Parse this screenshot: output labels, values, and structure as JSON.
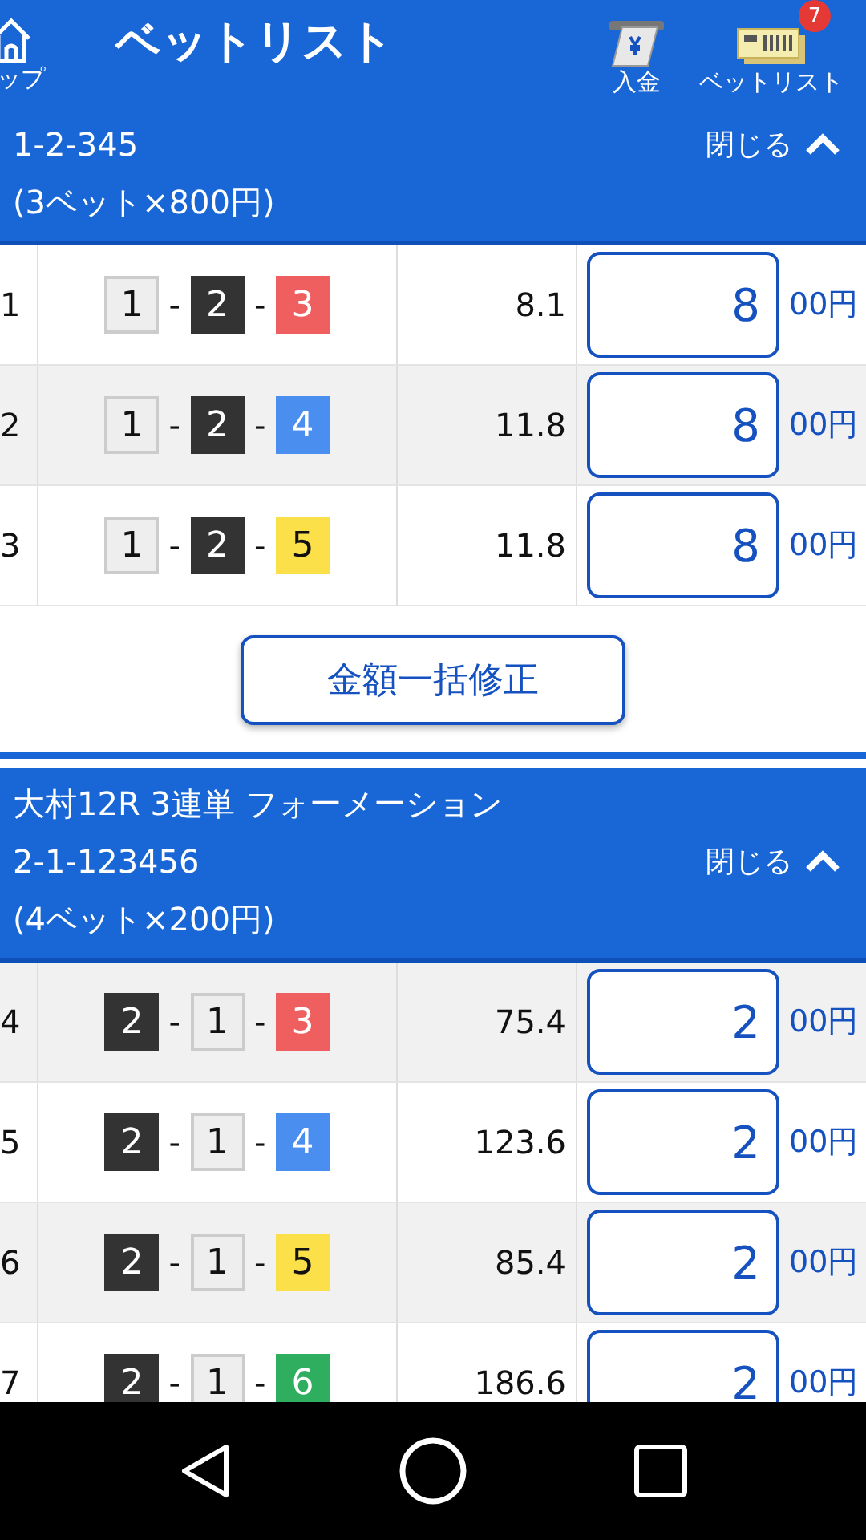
{
  "header": {
    "home_label": "ップ",
    "title": "ベットリスト",
    "actions": [
      {
        "kind": "deposit",
        "label": "入金"
      },
      {
        "kind": "betlist",
        "label": "ベットリスト",
        "badge": "7"
      }
    ]
  },
  "sections": [
    {
      "title_lines": [
        "1-2-345",
        "(3ベット×800円)"
      ],
      "toggle": "閉じる",
      "rows": [
        {
          "no": "1",
          "boats": [
            {
              "n": "1",
              "color": "#eeeeee"
            },
            {
              "n": "2",
              "color": "#333333"
            },
            {
              "n": "3",
              "color": "#ef5f5f"
            }
          ],
          "sep": "-",
          "odds": "8.1",
          "amount": "8",
          "unit": "00円"
        },
        {
          "no": "2",
          "boats": [
            {
              "n": "1",
              "color": "#eeeeee"
            },
            {
              "n": "2",
              "color": "#333333"
            },
            {
              "n": "4",
              "color": "#4a8ef0"
            }
          ],
          "sep": "-",
          "odds": "11.8",
          "amount": "8",
          "unit": "00円"
        },
        {
          "no": "3",
          "boats": [
            {
              "n": "1",
              "color": "#eeeeee"
            },
            {
              "n": "2",
              "color": "#333333"
            },
            {
              "n": "5",
              "color": "#fbe04a"
            }
          ],
          "sep": "-",
          "odds": "11.8",
          "amount": "8",
          "unit": "00円"
        }
      ],
      "button": "金額一括修正"
    },
    {
      "title_lines": [
        "大村12R 3連単 フォーメーション",
        "2-1-123456",
        "(4ベット×200円)"
      ],
      "toggle": "閉じる",
      "rows": [
        {
          "no": "4",
          "boats": [
            {
              "n": "2",
              "color": "#333333"
            },
            {
              "n": "1",
              "color": "#eeeeee"
            },
            {
              "n": "3",
              "color": "#ef5f5f"
            }
          ],
          "sep": "-",
          "odds": "75.4",
          "amount": "2",
          "unit": "00円"
        },
        {
          "no": "5",
          "boats": [
            {
              "n": "2",
              "color": "#333333"
            },
            {
              "n": "1",
              "color": "#eeeeee"
            },
            {
              "n": "4",
              "color": "#4a8ef0"
            }
          ],
          "sep": "-",
          "odds": "123.6",
          "amount": "2",
          "unit": "00円"
        },
        {
          "no": "6",
          "boats": [
            {
              "n": "2",
              "color": "#333333"
            },
            {
              "n": "1",
              "color": "#eeeeee"
            },
            {
              "n": "5",
              "color": "#fbe04a"
            }
          ],
          "sep": "-",
          "odds": "85.4",
          "amount": "2",
          "unit": "00円"
        },
        {
          "no": "7",
          "boats": [
            {
              "n": "2",
              "color": "#333333"
            },
            {
              "n": "1",
              "color": "#eeeeee"
            },
            {
              "n": "6",
              "color": "#2fae5f"
            }
          ],
          "sep": "-",
          "odds": "186.6",
          "amount": "2",
          "unit": "00円"
        }
      ]
    }
  ]
}
